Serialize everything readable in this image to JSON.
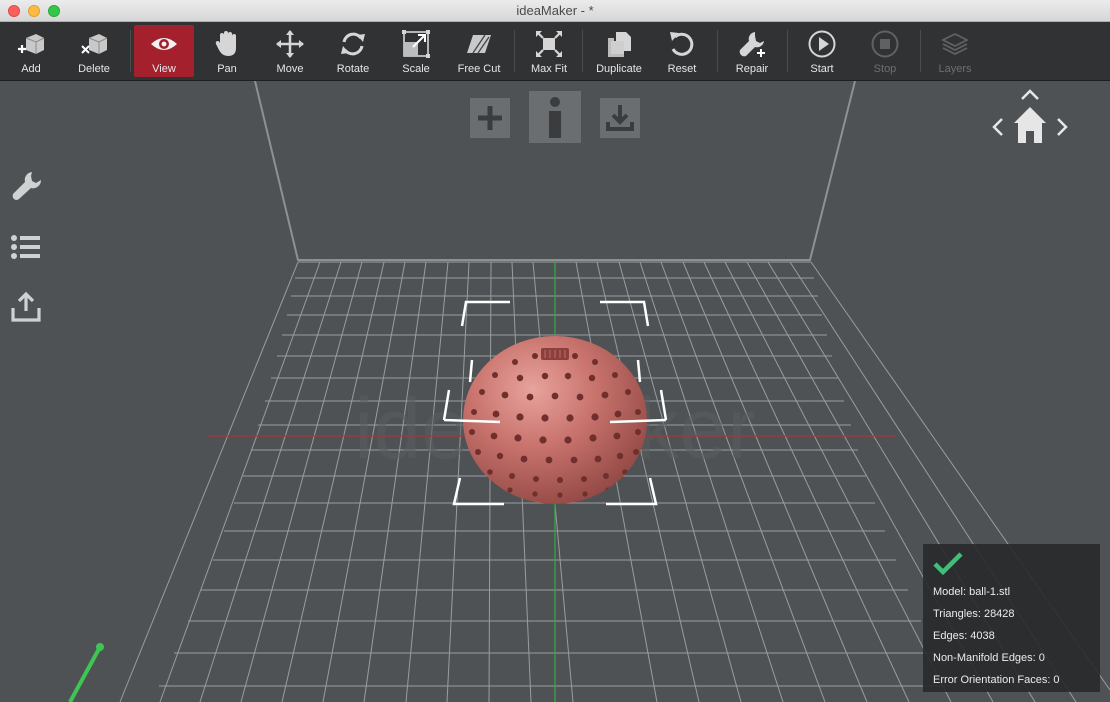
{
  "window": {
    "title": "ideaMaker -  *"
  },
  "toolbar": {
    "add": "Add",
    "delete": "Delete",
    "view": "View",
    "pan": "Pan",
    "move": "Move",
    "rotate": "Rotate",
    "scale": "Scale",
    "free_cut": "Free Cut",
    "max_fit": "Max Fit",
    "duplicate": "Duplicate",
    "reset": "Reset",
    "repair": "Repair",
    "start": "Start",
    "stop": "Stop",
    "layers": "Layers"
  },
  "viewport": {
    "watermark": "ideaMaker",
    "top_icons": [
      "plus-icon",
      "info-icon",
      "download-icon"
    ],
    "side_icons": [
      "wrench-icon",
      "list-icon",
      "upload-icon"
    ],
    "nav_icons": [
      "chevron-up-icon",
      "chevron-left-icon",
      "home-icon",
      "chevron-right-icon"
    ]
  },
  "model_info": {
    "status": "check-icon",
    "model": "Model: ball-1.stl",
    "triangles": "Triangles: 28428",
    "edges": "Edges: 4038",
    "non_manifold": "Non-Manifold Edges: 0",
    "error_faces": "Error Orientation Faces: 0"
  },
  "colors": {
    "active_tool": "#a3202c",
    "model": "#c26a66",
    "x_axis": "#a8353a",
    "y_axis": "#2fae47",
    "status_ok": "#3fbf7a"
  }
}
